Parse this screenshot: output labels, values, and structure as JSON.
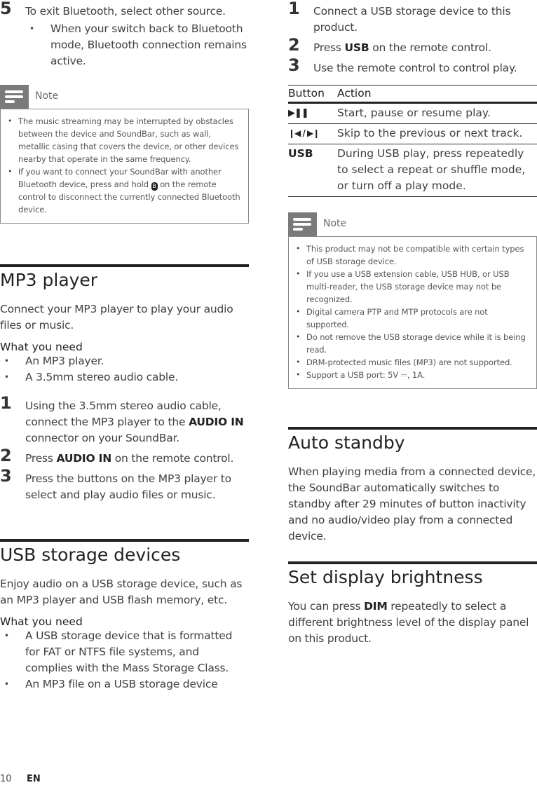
{
  "left_column": {
    "step5": {
      "number": "5",
      "text": "To exit Bluetooth, select other source.",
      "sub_bullet": "When your switch back to Bluetooth mode, Bluetooth connection remains active."
    },
    "note1": {
      "label": "Note",
      "icon": "note-icon",
      "items": [
        "The music streaming may be interrupted by obstacles between the device and SoundBar, such as wall, metallic casing that covers the device, or other devices nearby that operate in the same frequency.",
        "If you want to connect your SoundBar with another Bluetooth device, press and hold",
        "on the remote control to disconnect the currently connected Bluetooth device."
      ],
      "bluetooth_symbol": "B"
    },
    "mp3_section": {
      "title": "MP3 player",
      "intro": "Connect your MP3 player to play your audio files or music.",
      "need_heading": "What you need",
      "needs": [
        "An MP3 player.",
        "A 3.5mm stereo audio cable."
      ],
      "steps": [
        {
          "number": "1",
          "pre": "Using the 3.5mm stereo audio cable, connect the MP3 player to the ",
          "bold": "AUDIO IN",
          "post": " connector on your SoundBar."
        },
        {
          "number": "2",
          "pre": "Press ",
          "bold": "AUDIO IN",
          "post": " on the remote control."
        },
        {
          "number": "3",
          "pre": "Press the buttons on the MP3 player to select and play audio files or music.",
          "bold": "",
          "post": ""
        }
      ]
    },
    "usb_section": {
      "title": "USB storage devices",
      "intro": "Enjoy audio on a USB storage device, such as an MP3 player and USB flash memory, etc.",
      "need_heading": "What you need",
      "needs": [
        "A USB storage device that is formatted for FAT or NTFS file systems, and complies with the Mass Storage Class.",
        "An MP3 file on a USB storage device"
      ]
    }
  },
  "right_column": {
    "usb_steps": [
      {
        "number": "1",
        "pre": "Connect a USB storage device to this product.",
        "bold": "",
        "post": ""
      },
      {
        "number": "2",
        "pre": "Press ",
        "bold": "USB",
        "post": " on the remote control."
      },
      {
        "number": "3",
        "pre": "Use the remote control to control play.",
        "bold": "",
        "post": ""
      }
    ],
    "table": {
      "headers": [
        "Button",
        "Action"
      ],
      "rows": [
        {
          "button": "▶❚❚",
          "button_icon": "play-pause-icon",
          "action": "Start, pause or resume play."
        },
        {
          "button": "❙◀ / ▶❙",
          "button_icon": "prev-next-icon",
          "action": "Skip to the previous or next track."
        },
        {
          "button": "USB",
          "button_icon": "",
          "action": "During USB play, press repeatedly to select a repeat or shuffle mode, or turn off a play mode."
        }
      ]
    },
    "note2": {
      "label": "Note",
      "icon": "note-icon",
      "items": [
        "This product may not be compatible with certain types of USB storage device.",
        "If you use a USB extension cable, USB HUB, or USB multi-reader, the USB storage device may not be recognized.",
        "Digital camera PTP and MTP protocols are not supported.",
        "Do not remove the USB storage device while it is being read.",
        "DRM-protected music files (MP3) are not supported.",
        "Support a USB port: 5V ⎓, 1A."
      ]
    },
    "auto_standby": {
      "title": "Auto standby",
      "text": "When playing media from a connected device, the SoundBar automatically switches to standby after 29 minutes of button inactivity and no audio/video play from a connected device."
    },
    "brightness": {
      "title": "Set display brightness",
      "pre": "You can press ",
      "bold": "DIM",
      "post": " repeatedly to select a different brightness level of the display panel on this product."
    }
  },
  "footer": {
    "page_number": "10",
    "language": "EN"
  }
}
